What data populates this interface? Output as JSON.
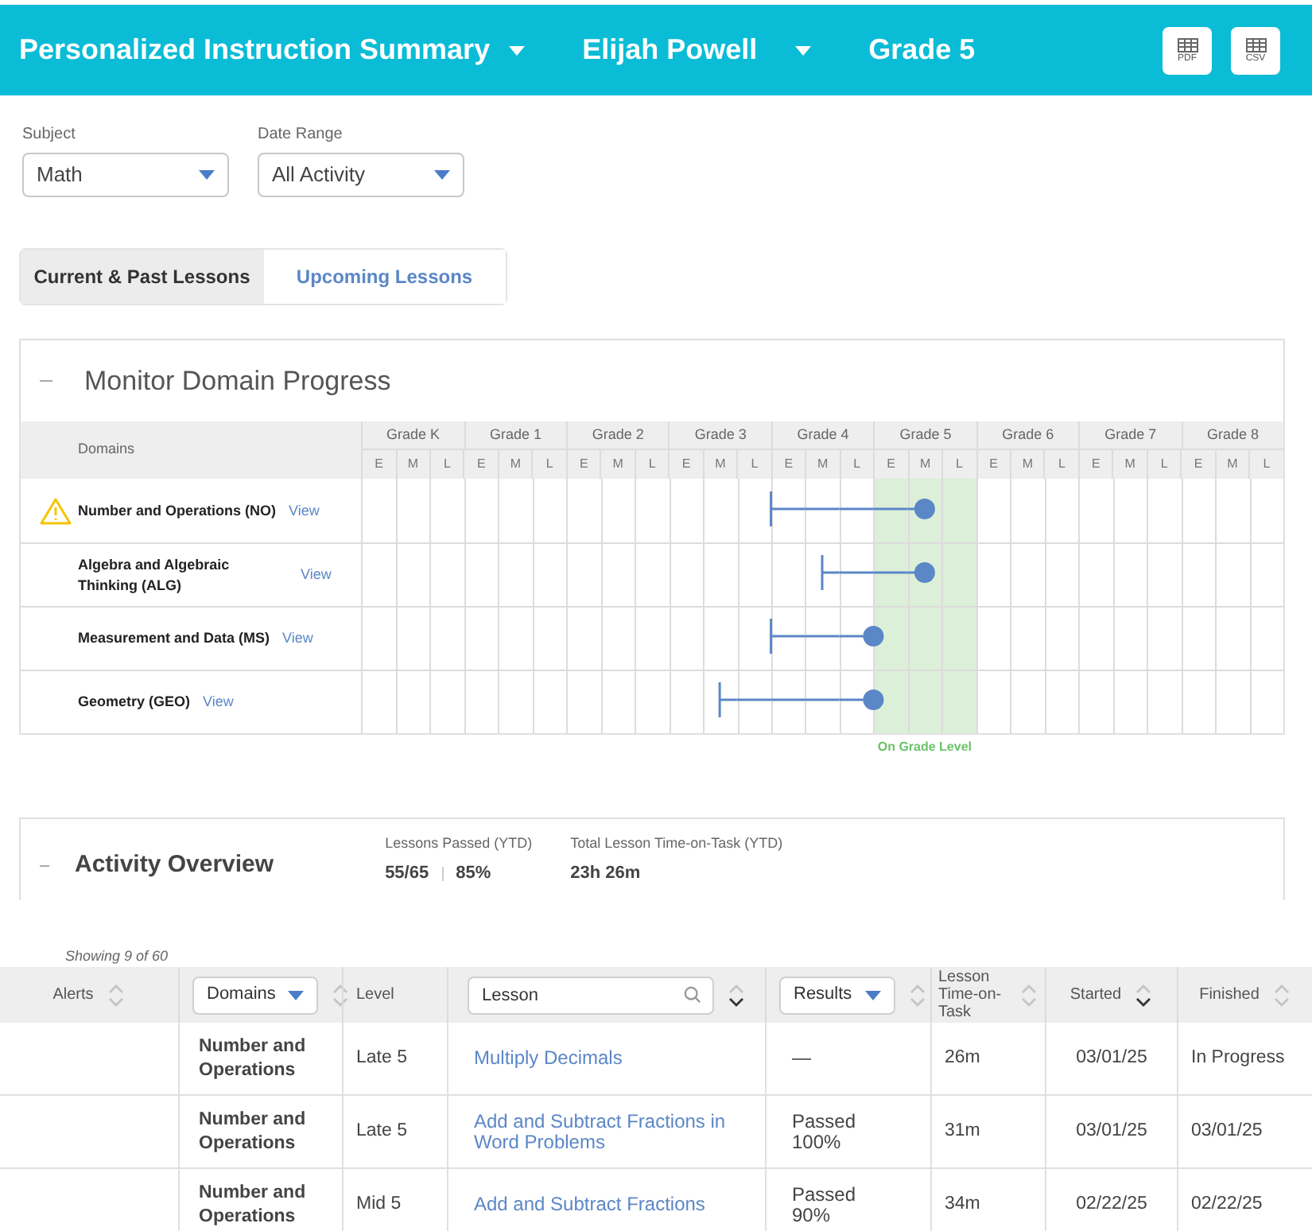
{
  "header": {
    "title": "Personalized Instruction Summary",
    "student": "Elijah Powell",
    "grade": "Grade 5",
    "exports": [
      "PDF",
      "CSV"
    ]
  },
  "filters": [
    {
      "label": "Subject",
      "value": "Math"
    },
    {
      "label": "Date Range",
      "value": "All Activity"
    }
  ],
  "tabs": [
    {
      "label": "Current & Past Lessons",
      "selected": true
    },
    {
      "label": "Upcoming Lessons",
      "selected": false
    }
  ],
  "domain_progress": {
    "title": "Monitor Domain Progress",
    "domains_heading": "Domains",
    "grades": [
      {
        "label": "Grade K",
        "bands": [
          "E",
          "M",
          "L"
        ],
        "on_grade": false
      },
      {
        "label": "Grade 1",
        "bands": [
          "E",
          "M",
          "L"
        ],
        "on_grade": false
      },
      {
        "label": "Grade 2",
        "bands": [
          "E",
          "M",
          "L"
        ],
        "on_grade": false
      },
      {
        "label": "Grade 3",
        "bands": [
          "E",
          "M",
          "L"
        ],
        "on_grade": false
      },
      {
        "label": "Grade 4",
        "bands": [
          "E",
          "M",
          "L"
        ],
        "on_grade": false
      },
      {
        "label": "Grade 5",
        "bands": [
          "E",
          "M",
          "L"
        ],
        "on_grade": true
      },
      {
        "label": "Grade 6",
        "bands": [
          "E",
          "M",
          "L"
        ],
        "on_grade": false
      },
      {
        "label": "Grade 7",
        "bands": [
          "E",
          "M",
          "L"
        ],
        "on_grade": false
      },
      {
        "label": "Grade 8",
        "bands": [
          "E",
          "M",
          "L"
        ],
        "on_grade": false
      }
    ],
    "domains": [
      {
        "name": "Number and Operations (NO)",
        "link": "View",
        "alert": true,
        "cells": [
          {
            "kind": "none"
          },
          {
            "kind": "none"
          },
          {
            "kind": "none"
          },
          {
            "kind": "none"
          },
          {
            "kind": "none"
          },
          {
            "kind": "none"
          },
          {
            "kind": "none"
          },
          {
            "kind": "none"
          },
          {
            "kind": "none"
          },
          {
            "kind": "none"
          },
          {
            "kind": "none"
          },
          {
            "kind": "none"
          },
          {
            "kind": "start"
          },
          {
            "kind": "line"
          },
          {
            "kind": "line"
          },
          {
            "kind": "line"
          },
          {
            "kind": "end_mid"
          },
          {
            "kind": "none"
          },
          {
            "kind": "none"
          },
          {
            "kind": "none"
          },
          {
            "kind": "none"
          },
          {
            "kind": "none"
          },
          {
            "kind": "none"
          },
          {
            "kind": "none"
          },
          {
            "kind": "none"
          },
          {
            "kind": "none"
          },
          {
            "kind": "none"
          }
        ]
      },
      {
        "name": "Algebra and Algebraic Thinking (ALG)",
        "link": "View",
        "alert": false,
        "cells": [
          {
            "kind": "none"
          },
          {
            "kind": "none"
          },
          {
            "kind": "none"
          },
          {
            "kind": "none"
          },
          {
            "kind": "none"
          },
          {
            "kind": "none"
          },
          {
            "kind": "none"
          },
          {
            "kind": "none"
          },
          {
            "kind": "none"
          },
          {
            "kind": "none"
          },
          {
            "kind": "none"
          },
          {
            "kind": "none"
          },
          {
            "kind": "none"
          },
          {
            "kind": "start_mid"
          },
          {
            "kind": "line"
          },
          {
            "kind": "line"
          },
          {
            "kind": "end_mid"
          },
          {
            "kind": "none"
          },
          {
            "kind": "none"
          },
          {
            "kind": "none"
          },
          {
            "kind": "none"
          },
          {
            "kind": "none"
          },
          {
            "kind": "none"
          },
          {
            "kind": "none"
          },
          {
            "kind": "none"
          },
          {
            "kind": "none"
          },
          {
            "kind": "none"
          }
        ]
      },
      {
        "name": "Measurement and Data (MS)",
        "link": "View",
        "alert": false,
        "cells": [
          {
            "kind": "none"
          },
          {
            "kind": "none"
          },
          {
            "kind": "none"
          },
          {
            "kind": "none"
          },
          {
            "kind": "none"
          },
          {
            "kind": "none"
          },
          {
            "kind": "none"
          },
          {
            "kind": "none"
          },
          {
            "kind": "none"
          },
          {
            "kind": "none"
          },
          {
            "kind": "none"
          },
          {
            "kind": "none"
          },
          {
            "kind": "start"
          },
          {
            "kind": "line"
          },
          {
            "kind": "end_edge"
          },
          {
            "kind": "none"
          },
          {
            "kind": "none"
          },
          {
            "kind": "none"
          },
          {
            "kind": "none"
          },
          {
            "kind": "none"
          },
          {
            "kind": "none"
          },
          {
            "kind": "none"
          },
          {
            "kind": "none"
          },
          {
            "kind": "none"
          },
          {
            "kind": "none"
          },
          {
            "kind": "none"
          },
          {
            "kind": "none"
          }
        ]
      },
      {
        "name": "Geometry (GEO)",
        "link": "View",
        "alert": false,
        "cells": [
          {
            "kind": "none"
          },
          {
            "kind": "none"
          },
          {
            "kind": "none"
          },
          {
            "kind": "none"
          },
          {
            "kind": "none"
          },
          {
            "kind": "none"
          },
          {
            "kind": "none"
          },
          {
            "kind": "none"
          },
          {
            "kind": "none"
          },
          {
            "kind": "none"
          },
          {
            "kind": "start_mid"
          },
          {
            "kind": "line"
          },
          {
            "kind": "line"
          },
          {
            "kind": "line"
          },
          {
            "kind": "end_edge"
          },
          {
            "kind": "none"
          },
          {
            "kind": "none"
          },
          {
            "kind": "none"
          },
          {
            "kind": "none"
          },
          {
            "kind": "none"
          },
          {
            "kind": "none"
          },
          {
            "kind": "none"
          },
          {
            "kind": "none"
          },
          {
            "kind": "none"
          },
          {
            "kind": "none"
          },
          {
            "kind": "none"
          },
          {
            "kind": "none"
          }
        ]
      }
    ],
    "on_grade_label": "On Grade Level"
  },
  "activity": {
    "title": "Activity Overview",
    "stats": [
      {
        "label": "Lessons Passed (YTD)",
        "values": [
          "55/65",
          "85%"
        ]
      },
      {
        "label": "Total Lesson Time-on-Task (YTD)",
        "values": [
          "23h 26m"
        ]
      }
    ]
  },
  "showing": "Showing 9 of 60",
  "table": {
    "columns": [
      {
        "label": "Alerts",
        "kind": "sort",
        "sorted": false
      },
      {
        "label": "Domains",
        "kind": "select",
        "sorted": false
      },
      {
        "label": "Level",
        "kind": "plain"
      },
      {
        "placeholder": "Lesson",
        "kind": "search",
        "sorted": true
      },
      {
        "label": "Results",
        "kind": "select",
        "sorted": false
      },
      {
        "label": "Lesson Time-on-Task",
        "kind": "sort",
        "sorted": false
      },
      {
        "label": "Started",
        "kind": "sort",
        "sorted": true
      },
      {
        "label": "Finished",
        "kind": "sort",
        "sorted": false
      }
    ],
    "rows": [
      {
        "domain": "Number and Operations",
        "level": "Late 5",
        "lesson": "Multiply Decimals",
        "result": "—",
        "time": "26m",
        "started": "03/01/25",
        "finished": "In Progress"
      },
      {
        "domain": "Number and Operations",
        "level": "Late 5",
        "lesson": "Add and Subtract Fractions in Word Problems",
        "result": "Passed 100%",
        "time": "31m",
        "started": "03/01/25",
        "finished": "03/01/25"
      },
      {
        "domain": "Number and Operations",
        "level": "Mid 5",
        "lesson": "Add and Subtract Fractions",
        "result": "Passed 90%",
        "time": "34m",
        "started": "02/22/25",
        "finished": "02/22/25"
      }
    ]
  }
}
